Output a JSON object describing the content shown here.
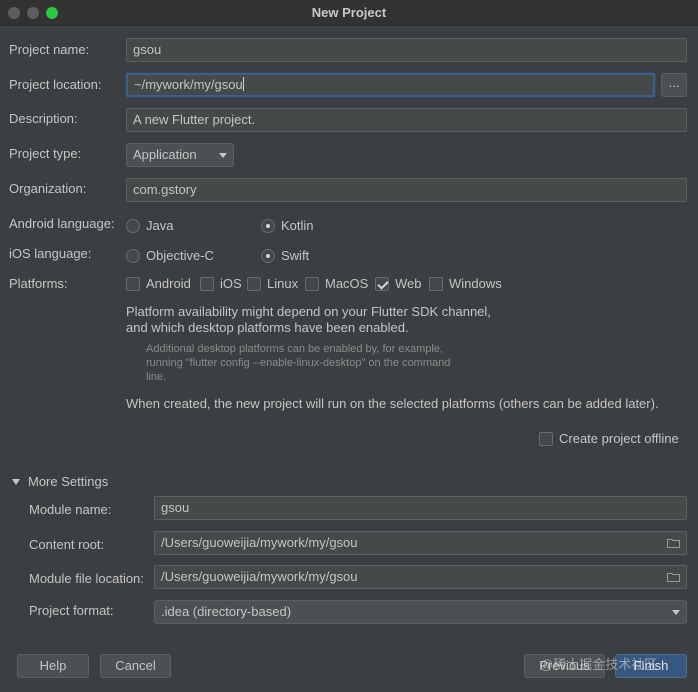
{
  "window": {
    "title": "New Project"
  },
  "labels": {
    "project_name": "Project name:",
    "project_location": "Project location:",
    "description": "Description:",
    "project_type": "Project type:",
    "organization": "Organization:",
    "android_language": "Android language:",
    "ios_language": "iOS language:",
    "platforms": "Platforms:"
  },
  "fields": {
    "project_name": "gsou",
    "project_location": "~/mywork/my/gsou",
    "browse": "...",
    "description": "A new Flutter project.",
    "project_type": "Application",
    "organization": "com.gstory"
  },
  "android_language": {
    "options": [
      {
        "label": "Java",
        "selected": false
      },
      {
        "label": "Kotlin",
        "selected": true
      }
    ]
  },
  "ios_language": {
    "options": [
      {
        "label": "Objective-C",
        "selected": false
      },
      {
        "label": "Swift",
        "selected": true
      }
    ]
  },
  "platforms": [
    {
      "label": "Android",
      "checked": false
    },
    {
      "label": "iOS",
      "checked": false
    },
    {
      "label": "Linux",
      "checked": false
    },
    {
      "label": "MacOS",
      "checked": false
    },
    {
      "label": "Web",
      "checked": true
    },
    {
      "label": "Windows",
      "checked": false
    }
  ],
  "info": {
    "availability_line1": "Platform availability might depend on your Flutter SDK channel,",
    "availability_line2": "and which desktop platforms have been enabled.",
    "desktop_line1": "Additional desktop platforms can be enabled by, for example,",
    "desktop_line2": "running \"flutter config --enable-linux-desktop\" on the command",
    "desktop_line3": "line.",
    "when_created": "When created, the new project will run on the selected platforms (others can be added later)."
  },
  "offline": {
    "label": "Create project offline",
    "checked": false
  },
  "more_settings": {
    "title": "More Settings",
    "module_name_label": "Module name:",
    "module_name": "gsou",
    "content_root_label": "Content root:",
    "content_root": "/Users/guoweijia/mywork/my/gsou",
    "module_file_location_label": "Module file location:",
    "module_file_location": "/Users/guoweijia/mywork/my/gsou",
    "project_format_label": "Project format:",
    "project_format": ".idea (directory-based)"
  },
  "buttons": {
    "help": "Help",
    "cancel": "Cancel",
    "previous": "Previous",
    "finish": "Finish"
  },
  "watermark": "@稀土掘金技术社区",
  "colors": {
    "background": "#3c3f41",
    "field": "#45494a",
    "focus_border": "#3d6185",
    "primary_button": "#365880"
  }
}
